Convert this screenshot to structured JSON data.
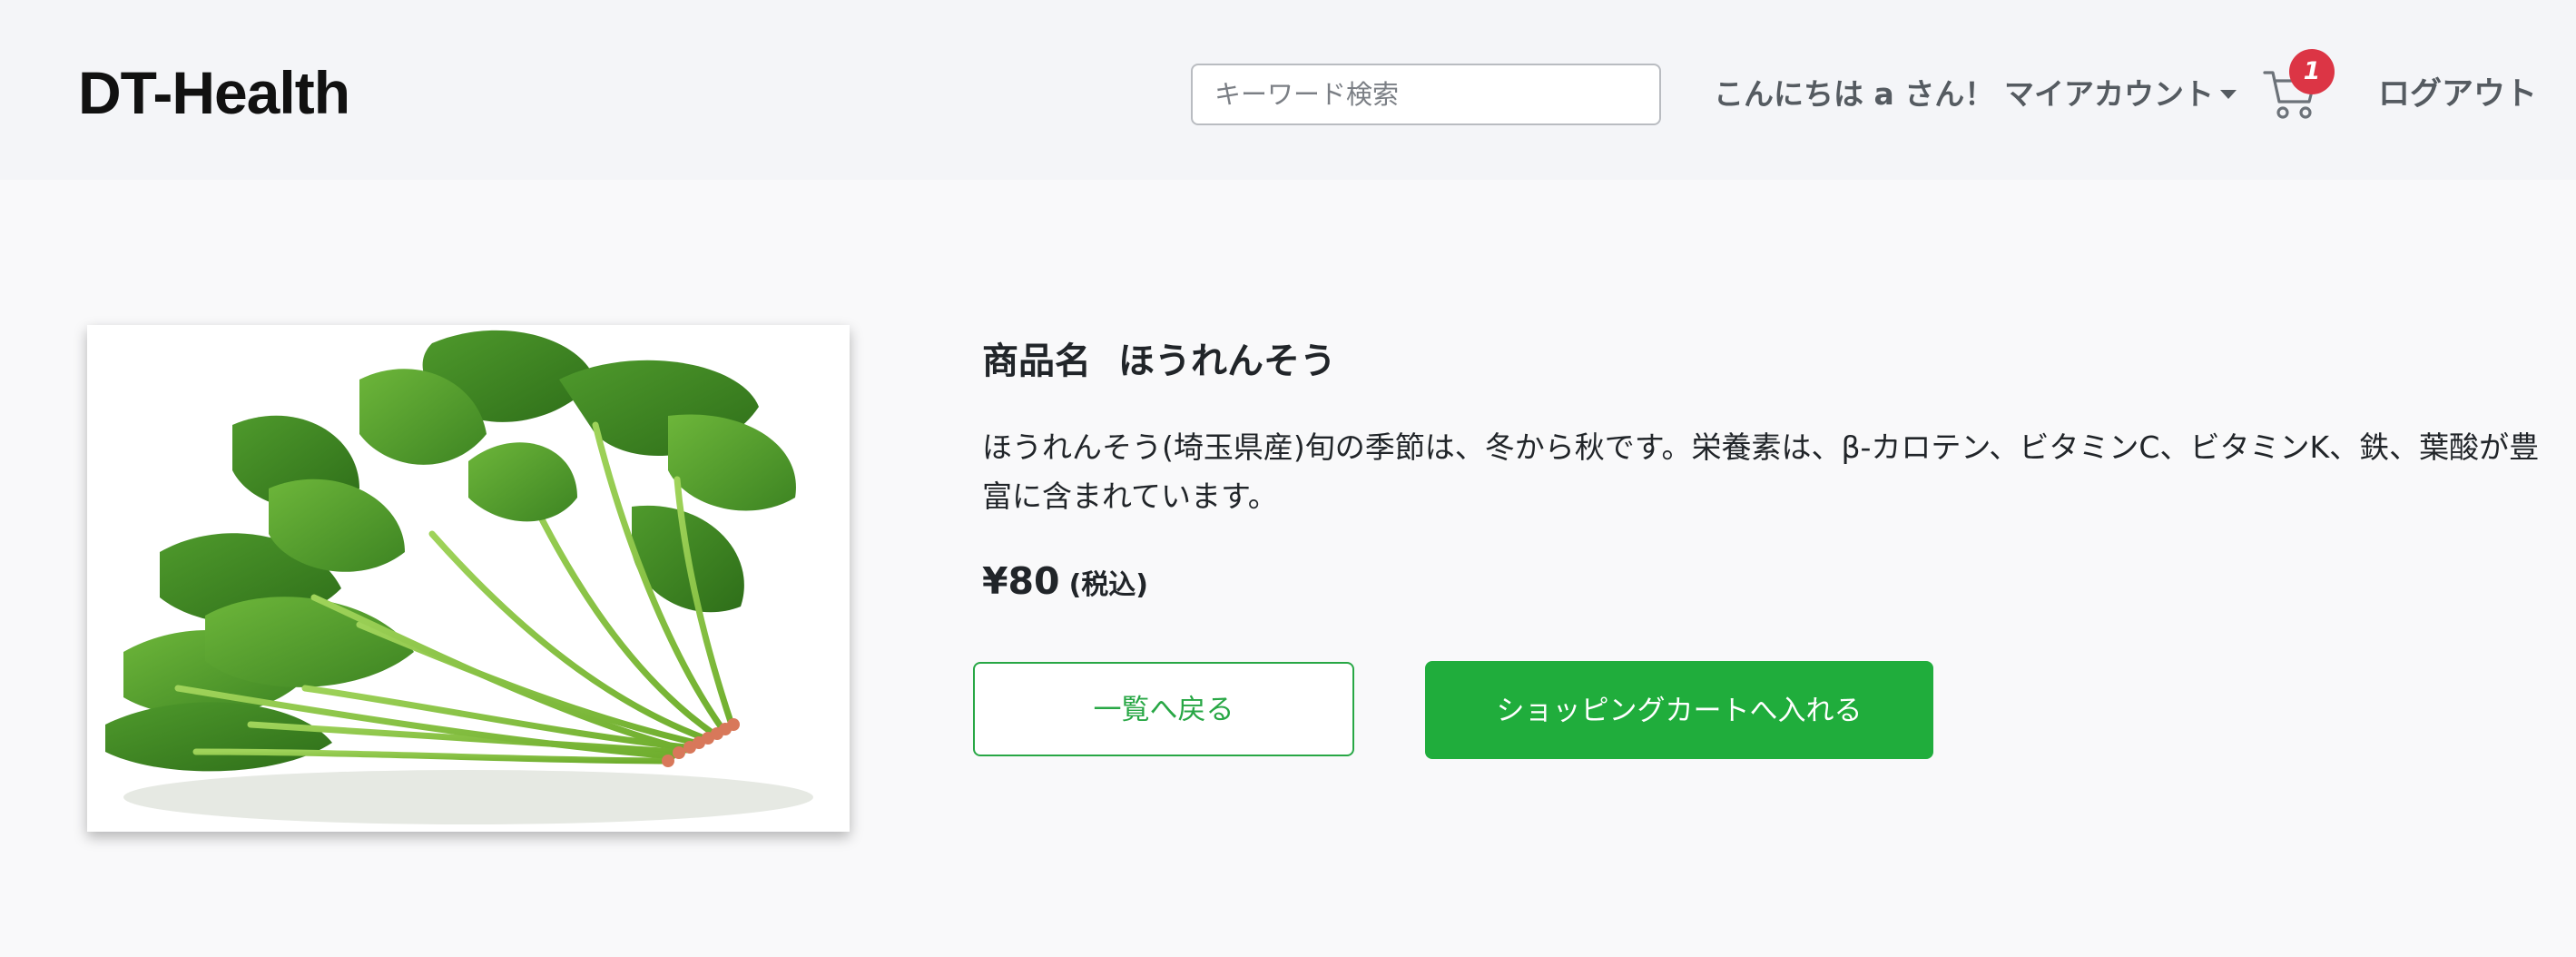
{
  "header": {
    "brand": "DT-Health",
    "search_placeholder": "キーワード検索",
    "greeting": "こんにちは a さん！",
    "account_menu": "マイアカウント",
    "cart_count": "1",
    "logout": "ログアウト"
  },
  "product": {
    "name_label": "商品名",
    "name": "ほうれんそう",
    "description": "ほうれんそう(埼玉県産)旬の季節は、冬から秋です。栄養素は、β-カロテン、ビタミンC、ビタミンK、鉄、葉酸が豊富に含まれています。",
    "price": "¥80",
    "tax_note": "(税込)"
  },
  "actions": {
    "back_label": "一覧へ戻る",
    "add_to_cart_label": "ショッピングカートへ入れる"
  },
  "colors": {
    "primary_green": "#20ad3c",
    "badge_red": "#dc3545",
    "nav_background": "#f4f5f8"
  },
  "icons": {
    "cart": "shopping-cart-icon",
    "dropdown": "caret-down-icon"
  }
}
